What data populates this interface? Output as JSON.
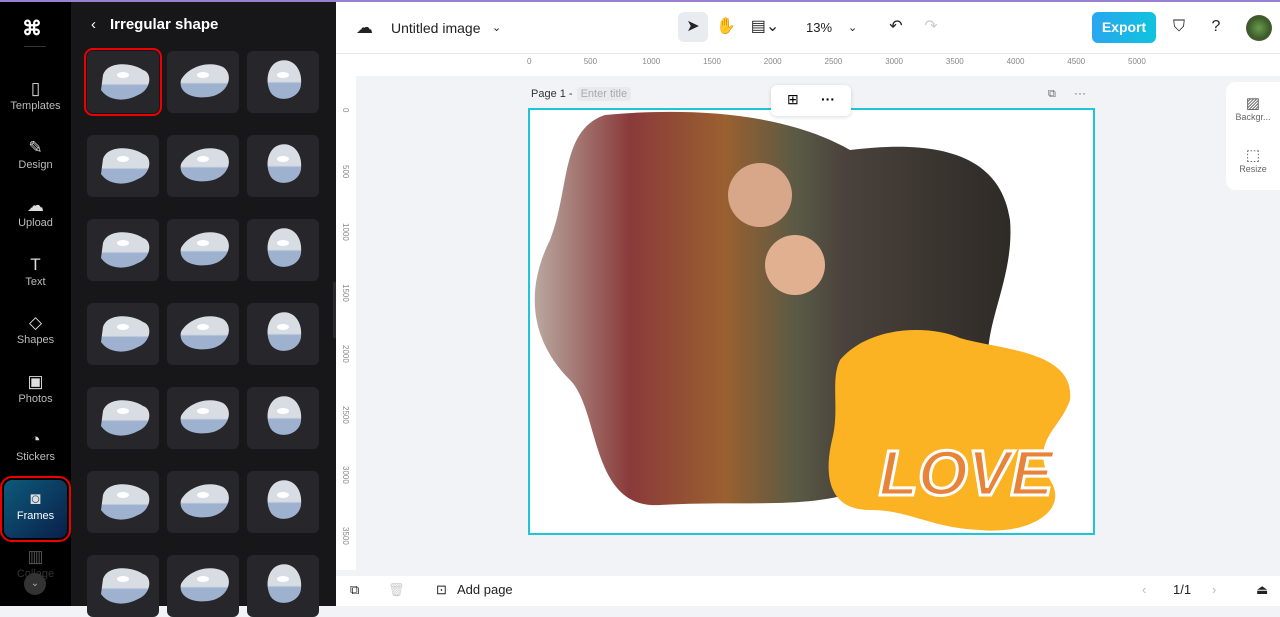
{
  "rail": {
    "items": [
      {
        "label": "Templates",
        "icon": "templates-icon"
      },
      {
        "label": "Design",
        "icon": "design-icon"
      },
      {
        "label": "Upload",
        "icon": "upload-icon"
      },
      {
        "label": "Text",
        "icon": "text-icon"
      },
      {
        "label": "Shapes",
        "icon": "shapes-icon"
      },
      {
        "label": "Photos",
        "icon": "photos-icon"
      },
      {
        "label": "Stickers",
        "icon": "stickers-icon"
      },
      {
        "label": "Frames",
        "icon": "frames-icon"
      },
      {
        "label": "Collage",
        "icon": "collage-icon"
      }
    ]
  },
  "panel": {
    "title": "Irregular shape",
    "back": "‹",
    "tiles": 21,
    "selected_index": 0
  },
  "topbar": {
    "title": "Untitled image",
    "zoom": "13%",
    "export": "Export"
  },
  "ruler": {
    "h": [
      "0",
      "500",
      "1000",
      "1500",
      "2000",
      "2500",
      "3000",
      "3500",
      "4000",
      "4500",
      "5000"
    ],
    "v": [
      "0",
      "500",
      "1000",
      "1500",
      "2000",
      "2500",
      "3000",
      "3500"
    ]
  },
  "page": {
    "label": "Page 1 -",
    "title_placeholder": "Enter title",
    "text": "LOVE"
  },
  "side": {
    "background": "Backgr...",
    "resize": "Resize"
  },
  "bottom": {
    "add_page": "Add page",
    "page_count": "1/1"
  },
  "colors": {
    "accent": "#1cc6d8",
    "blob": "#fbb324",
    "love": "#e8843a"
  }
}
